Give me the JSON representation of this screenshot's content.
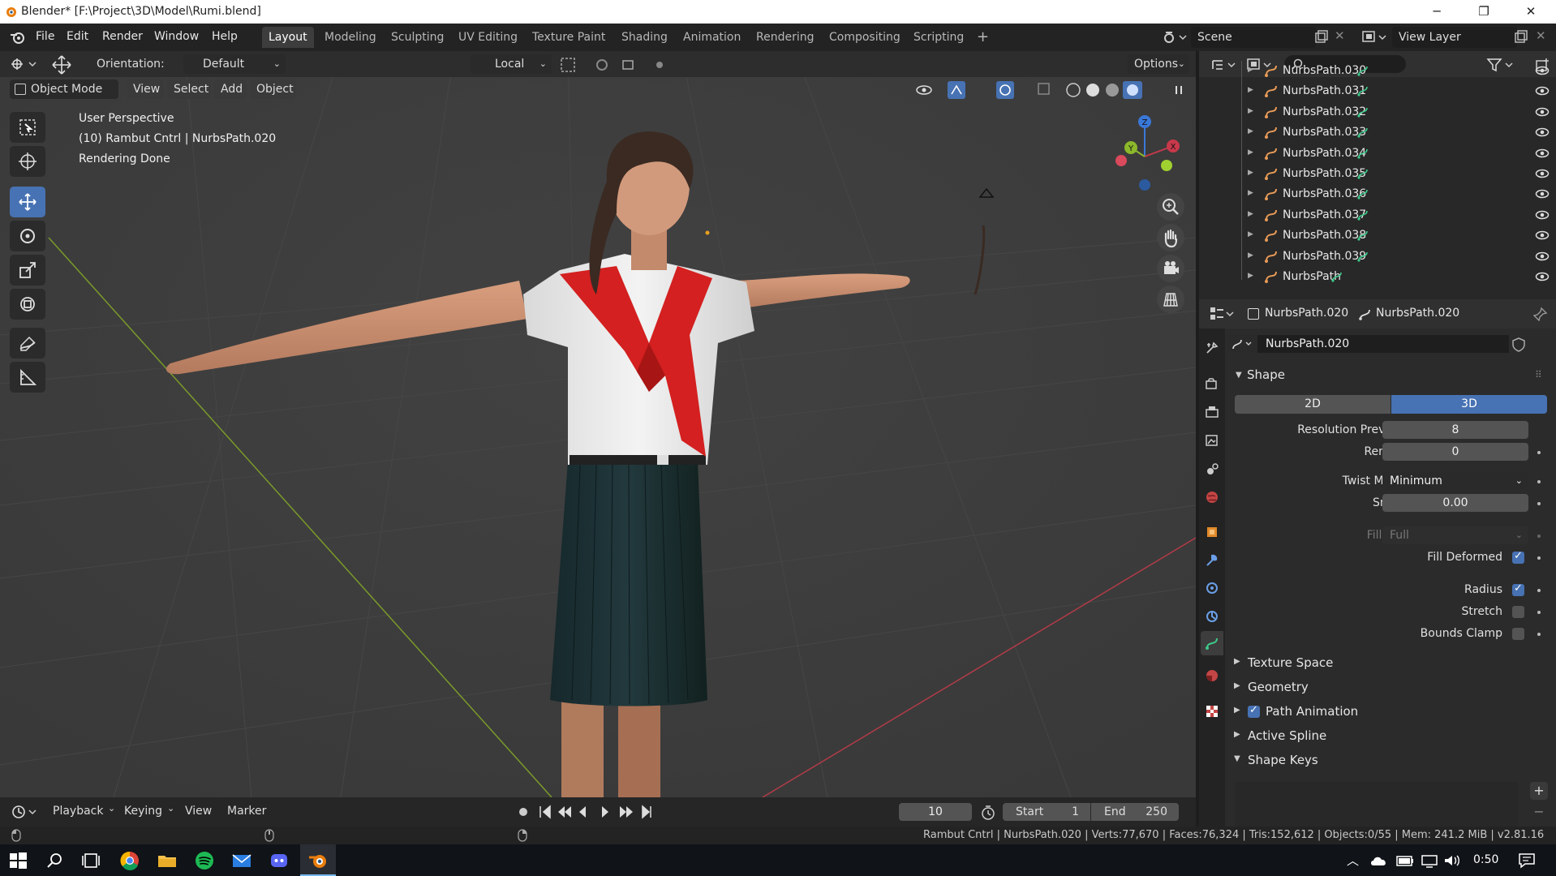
{
  "window": {
    "title": "Blender* [F:\\Project\\3D\\Model\\Rumi.blend]",
    "minimize": "─",
    "maximize": "❐",
    "close": "✕"
  },
  "menu": {
    "file": "File",
    "edit": "Edit",
    "render": "Render",
    "window": "Window",
    "help": "Help"
  },
  "workspaces": [
    "Layout",
    "Modeling",
    "Sculpting",
    "UV Editing",
    "Texture Paint",
    "Shading",
    "Animation",
    "Rendering",
    "Compositing",
    "Scripting"
  ],
  "active_workspace": "Layout",
  "add_workspace": "+",
  "scene": "Scene",
  "view_layer": "View Layer",
  "viewport_header": {
    "orientation_label": "Orientation:",
    "orientation_value": "Default",
    "pivot": "Local",
    "options": "Options",
    "mode": "Object Mode",
    "view": "View",
    "select": "Select",
    "add": "Add",
    "object": "Object"
  },
  "overlay": {
    "perspective": "User Perspective",
    "object_info": "(10) Rambut Cntrl | NurbsPath.020",
    "status": "Rendering Done"
  },
  "gizmo": {
    "z": "Z",
    "y": "Y",
    "x": "X"
  },
  "outliner": {
    "rows": [
      "NurbsPath.030",
      "NurbsPath.031",
      "NurbsPath.032",
      "NurbsPath.033",
      "NurbsPath.034",
      "NurbsPath.035",
      "NurbsPath.036",
      "NurbsPath.037",
      "NurbsPath.038",
      "NurbsPath.039",
      "NurbsPath"
    ]
  },
  "properties": {
    "object_name": "NurbsPath.020",
    "data_name": "NurbsPath.020",
    "datablock": "NurbsPath.020",
    "shape_header": "Shape",
    "dim_2d": "2D",
    "dim_3d": "3D",
    "resolution_preview_label": "Resolution Preview U",
    "resolution_preview_value": "8",
    "render_u_label": "Render U",
    "render_u_value": "0",
    "twist_method_label": "Twist Method",
    "twist_method_value": "Minimum",
    "smooth_label": "Smooth",
    "smooth_value": "0.00",
    "fill_mode_label": "Fill Mode",
    "fill_mode_value": "Full",
    "fill_deformed_label": "Fill Deformed",
    "radius_label": "Radius",
    "stretch_label": "Stretch",
    "bounds_clamp_label": "Bounds Clamp",
    "texture_space": "Texture Space",
    "geometry": "Geometry",
    "path_animation": "Path Animation",
    "active_spline": "Active Spline",
    "shape_keys": "Shape Keys",
    "add": "+",
    "remove": "−"
  },
  "timeline": {
    "playback": "Playback",
    "keying": "Keying",
    "view": "View",
    "marker": "Marker",
    "current_frame": "10",
    "start_label": "Start",
    "start_value": "1",
    "end_label": "End",
    "end_value": "250"
  },
  "statusbar": {
    "info": "Rambut Cntrl | NurbsPath.020 | Verts:77,670 | Faces:76,324 | Tris:152,612 | Objects:0/55 | Mem: 241.2 MiB | v2.81.16"
  },
  "taskbar": {
    "time": "0:50"
  },
  "colors": {
    "accent": "#4772b3",
    "viewport_bg": "#3d3d3d",
    "x_axis": "#c8394b",
    "y_axis": "#8cb82b",
    "z_axis": "#3a78d8"
  }
}
